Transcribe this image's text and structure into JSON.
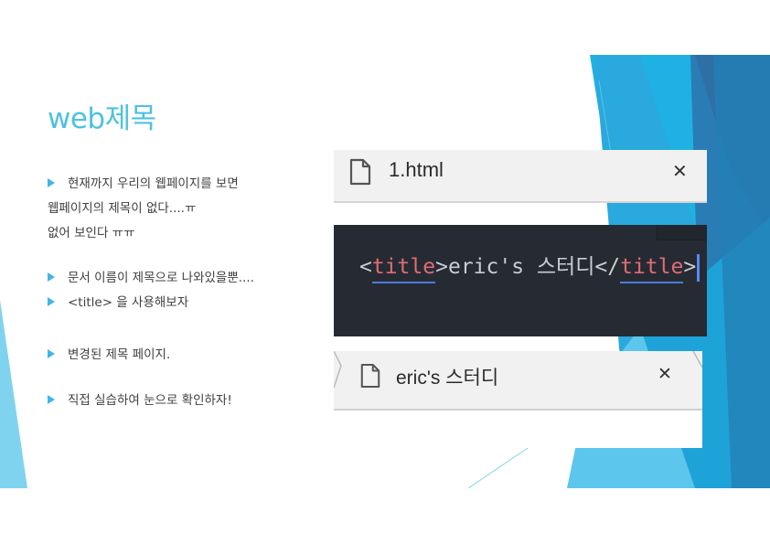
{
  "slide": {
    "title": "web제목",
    "lines": [
      {
        "bullet": true,
        "text": "현재까지 우리의 웹페이지를 보면"
      },
      {
        "bullet": false,
        "text": "웹페이지의 제목이 없다....ㅠ"
      },
      {
        "bullet": false,
        "text": "없어 보인다 ㅠㅠ"
      },
      {
        "bullet": true,
        "text": "문서 이름이 제목으로 나와있을뿐...."
      },
      {
        "bullet": true,
        "text": "<title> 을 사용해보자"
      },
      {
        "bullet": true,
        "text": "변경된 제목 페이지."
      },
      {
        "bullet": true,
        "text": "직접 실습하여 눈으로 확인하자!"
      }
    ]
  },
  "screenshot_tab_before": {
    "label": "1.html",
    "close_glyph": "✕",
    "icon": "file-icon"
  },
  "screenshot_code": {
    "open_lt": "<",
    "open_tag": "title",
    "open_gt": ">",
    "content": "eric's 스터디",
    "close_lt": "</",
    "close_tag": "title",
    "close_gt": ">"
  },
  "screenshot_tab_after": {
    "label": "eric's 스터디",
    "close_glyph": "✕",
    "icon": "file-icon"
  },
  "colors": {
    "title": "#4fc1e0",
    "bullet": "#41b6e6",
    "editor_bg": "#262b33",
    "tag": "#e06c75",
    "underline": "#4c7cd9",
    "cursor": "#528bff"
  }
}
